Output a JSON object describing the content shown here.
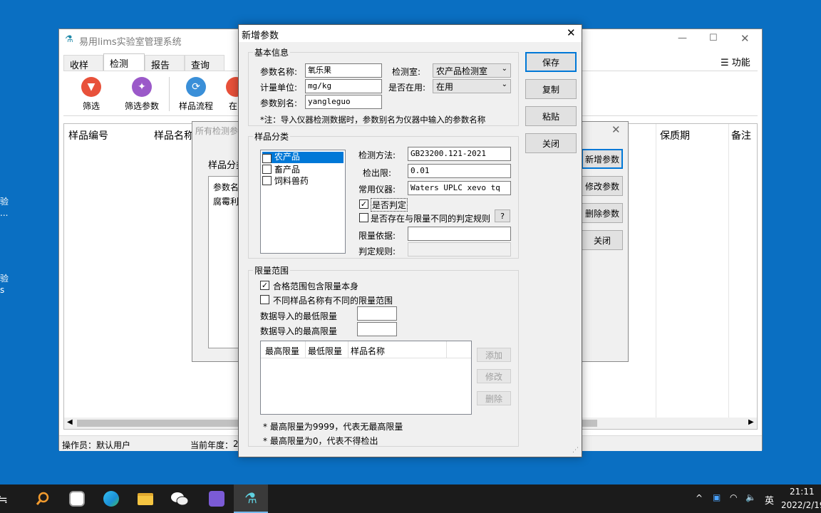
{
  "desktop": {
    "labels": [
      "验",
      "...",
      "验",
      "s"
    ]
  },
  "main_window": {
    "title": "易用lims实验室管理系统",
    "tabs": [
      "收样",
      "检测",
      "报告",
      "查询"
    ],
    "function_menu": "功能",
    "ribbon": [
      "筛选",
      "筛选参数",
      "样品流程",
      "在"
    ],
    "columns": [
      "样品编号",
      "样品名称",
      "保质期",
      "备注"
    ],
    "status": {
      "operator": "操作员：默认用户",
      "year": "当前年度：",
      "year_value": "2"
    }
  },
  "sub_dialog": {
    "title": "所有检测参",
    "sample_class_label": "样品分类",
    "param_label": "参数名",
    "first_param": "腐霉利",
    "buttons": [
      "新增参数",
      "修改参数",
      "删除参数",
      "关闭"
    ]
  },
  "dialog": {
    "title": "新增参数",
    "basic": {
      "title": "基本信息",
      "name_label": "参数名称:",
      "name_value": "氧乐果",
      "lab_label": "检测室:",
      "lab_value": "农产品检测室",
      "unit_label": "计量单位:",
      "unit_value": "mg/kg",
      "active_label": "是否在用:",
      "active_value": "在用",
      "alias_label": "参数别名:",
      "alias_value": "yangleguo",
      "note": "*注：导入仪器检测数据时，参数别名为仪器中输入的参数名称"
    },
    "category": {
      "title": "样品分类",
      "items": [
        {
          "label": "农产品",
          "checked": true,
          "selected": true
        },
        {
          "label": "畜产品",
          "checked": false,
          "selected": false
        },
        {
          "label": "饲料兽药",
          "checked": false,
          "selected": false
        }
      ],
      "method_label": "检测方法:",
      "method_value": "GB23200.121-2021",
      "lod_label": "检出限:",
      "lod_value": "0.01",
      "instrument_label": "常用仪器:",
      "instrument_value": "Waters UPLC xevo tq",
      "judge_label": "是否判定",
      "judge_checked": true,
      "diff_rule_label": "是否存在与限量不同的判定规则",
      "diff_rule_checked": false,
      "help": "?",
      "basis_label": "限量依据:",
      "basis_value": "",
      "rule_label": "判定规则:",
      "rule_value": ""
    },
    "limits": {
      "title": "限量范围",
      "include_label": "合格范围包含限量本身",
      "include_checked": true,
      "diff_label": "不同样品名称有不同的限量范围",
      "diff_checked": false,
      "min_label": "数据导入的最低限量",
      "max_label": "数据导入的最高限量",
      "table_cols": [
        "最高限量",
        "最低限量",
        "样品名称"
      ],
      "add": "添加",
      "edit": "修改",
      "delete": "删除",
      "note1": "* 最高限量为9999，代表无最高限量",
      "note2": "* 最高限量为0，代表不得检出"
    },
    "buttons": {
      "save": "保存",
      "copy": "复制",
      "paste": "粘贴",
      "close": "关闭"
    }
  },
  "taskbar": {
    "ime": "英",
    "time": "21:11",
    "date": "2022/2/19",
    "left_fragment": "≒"
  }
}
